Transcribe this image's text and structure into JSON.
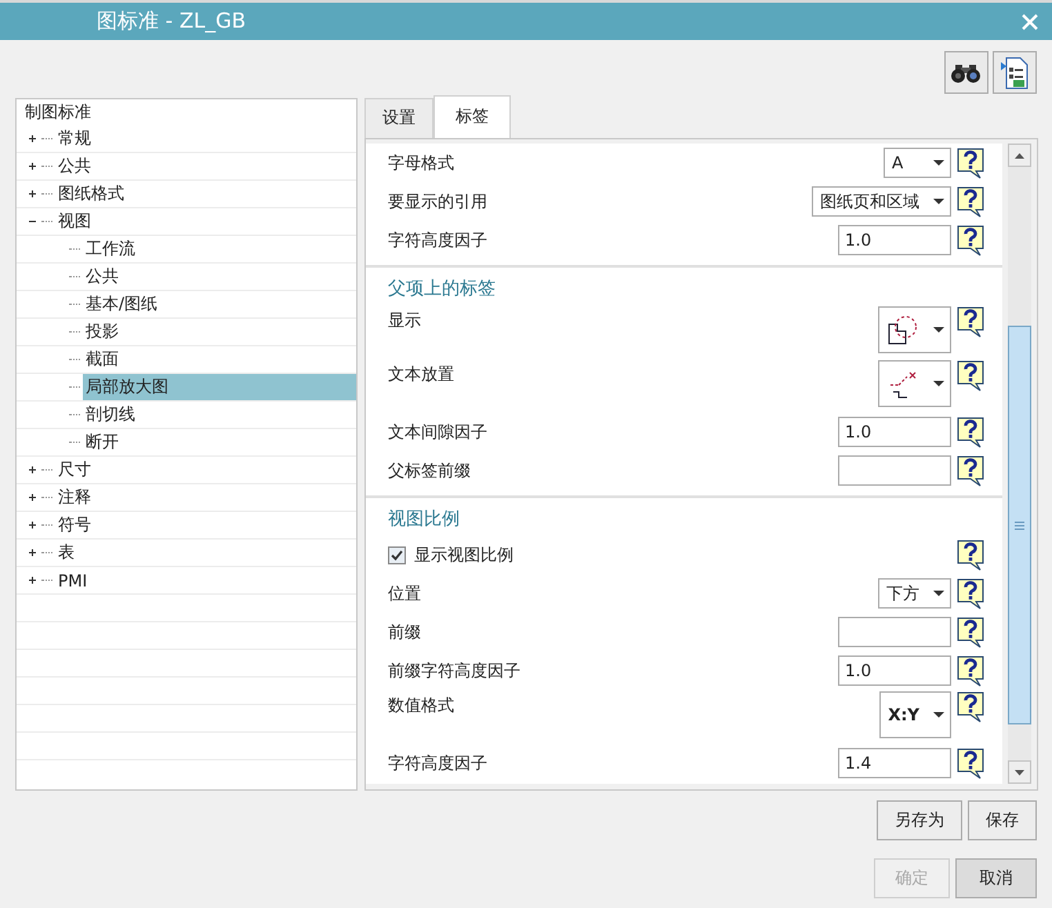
{
  "window": {
    "title": "图标准 - ZL_GB"
  },
  "tree": {
    "label": "制图标准",
    "selected": false,
    "children": [
      {
        "label": "常规",
        "expanded": false,
        "selected": false
      },
      {
        "label": "公共",
        "expanded": false,
        "selected": false
      },
      {
        "label": "图纸格式",
        "expanded": false,
        "selected": false
      },
      {
        "label": "视图",
        "expanded": true,
        "selected": false,
        "children": [
          {
            "label": "工作流",
            "selected": false
          },
          {
            "label": "公共",
            "selected": false
          },
          {
            "label": "基本/图纸",
            "selected": false
          },
          {
            "label": "投影",
            "selected": false
          },
          {
            "label": "截面",
            "selected": false
          },
          {
            "label": "局部放大图",
            "selected": true
          },
          {
            "label": "剖切线",
            "selected": false
          },
          {
            "label": "断开",
            "selected": false
          }
        ]
      },
      {
        "label": "尺寸",
        "expanded": false,
        "selected": false
      },
      {
        "label": "注释",
        "expanded": false,
        "selected": false
      },
      {
        "label": "符号",
        "expanded": false,
        "selected": false
      },
      {
        "label": "表",
        "expanded": false,
        "selected": false
      },
      {
        "label": "PMI",
        "expanded": false,
        "selected": false
      }
    ]
  },
  "tabs": [
    {
      "label": "设置",
      "selected": false
    },
    {
      "label": "标签",
      "selected": true
    }
  ],
  "sections": [
    {
      "rows": [
        {
          "kind": "dropdown",
          "label": "字母格式",
          "value": "A"
        },
        {
          "kind": "dropdown",
          "label": "要显示的引用",
          "value": "图纸页和区域"
        },
        {
          "kind": "field",
          "label": "字符高度因子",
          "value": "1.0"
        }
      ]
    },
    {
      "title": "父项上的标签",
      "rows": [
        {
          "kind": "boundary-dropdown",
          "label": "显示"
        },
        {
          "kind": "placement-dropdown",
          "label": "文本放置"
        },
        {
          "kind": "field",
          "label": "文本间隙因子",
          "value": "1.0"
        },
        {
          "kind": "field",
          "label": "父标签前缀"
        }
      ]
    },
    {
      "title": "视图比例",
      "rows": [
        {
          "kind": "checkbox",
          "label": "显示视图比例",
          "checked": true
        },
        {
          "kind": "dropdown",
          "label": "位置",
          "value": "下方"
        },
        {
          "kind": "field",
          "label": "前缀"
        },
        {
          "kind": "field",
          "label": "前缀字符高度因子",
          "value": "1.0"
        },
        {
          "kind": "tall-dropdown",
          "label": "数值格式",
          "value": "X:Y"
        },
        {
          "kind": "field",
          "label": "字符高度因子",
          "value": "1.4"
        }
      ]
    }
  ],
  "buttons": [
    {
      "label": "另存为",
      "disabled": false
    },
    {
      "label": "保存",
      "disabled": false
    },
    {
      "label": "确定",
      "disabled": true
    },
    {
      "label": "取消",
      "disabled": false
    }
  ]
}
